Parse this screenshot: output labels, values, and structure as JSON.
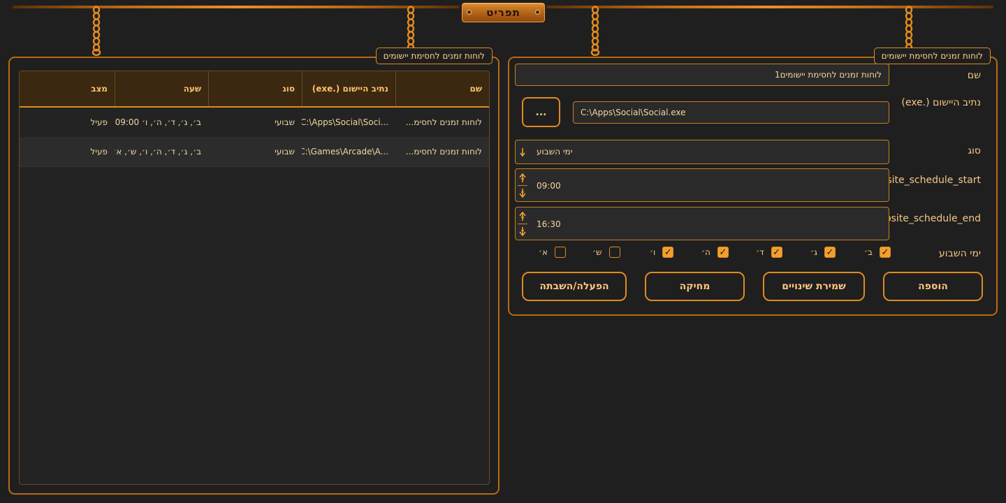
{
  "menu": {
    "label": "תפריט"
  },
  "form": {
    "panel_title": "לוחות זמנים לחסימת יישומים",
    "name_label": "שם",
    "name_value": "לוחות זמנים לחסימת יישומים1",
    "path_label": "נתיב היישום (.exe)",
    "path_value": "C:\\Apps\\Social\\Social.exe",
    "browse_label": "...",
    "type_label": "סוג",
    "type_value": "ימי השבוע",
    "start_label": "website_schedule_start",
    "start_value": "09:00",
    "end_label": "website_schedule_end",
    "end_value": "16:30",
    "days_label": "ימי השבוע",
    "days": [
      {
        "label": "ב׳",
        "checked": true
      },
      {
        "label": "ג׳",
        "checked": true
      },
      {
        "label": "ד׳",
        "checked": true
      },
      {
        "label": "ה׳",
        "checked": true
      },
      {
        "label": "ו׳",
        "checked": true
      },
      {
        "label": "ש׳",
        "checked": false
      },
      {
        "label": "א׳",
        "checked": false
      }
    ],
    "buttons": {
      "add": "הוספה",
      "save": "שמירת שינויים",
      "delete": "מחיקה",
      "toggle": "הפעלה/השבתה"
    }
  },
  "list": {
    "panel_title": "לוחות זמנים לחסימת יישומים",
    "columns": [
      "שם",
      "נתיב היישום (.exe)",
      "סוג",
      "שעה",
      "מצב"
    ],
    "rows": [
      {
        "name": "לוחות זמנים לחסימ...",
        "path": "C:\\Apps\\Social\\Soci...",
        "type": "שבועי",
        "time": "ב׳, ג׳, ד׳, ה׳, ו׳  09:00...",
        "status": "פעיל"
      },
      {
        "name": "לוחות זמנים לחסימ...",
        "path": "C:\\Games\\Arcade\\A...",
        "type": "שבועי",
        "time": "ב׳, ג׳, ד׳, ה׳, ו׳, ש׳, א׳...",
        "status": "פעיל"
      }
    ]
  },
  "colors": {
    "accent": "#e08a20",
    "background": "#1f1f1f",
    "text": "#f5c784",
    "checked": "#f0a030"
  }
}
